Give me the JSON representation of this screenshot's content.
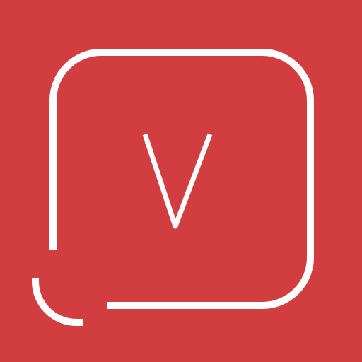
{
  "icon": {
    "name": "v-chat-bubble-app-icon",
    "letter": "V",
    "colors": {
      "background": "#d23e40",
      "stroke": "#ffffff"
    }
  }
}
